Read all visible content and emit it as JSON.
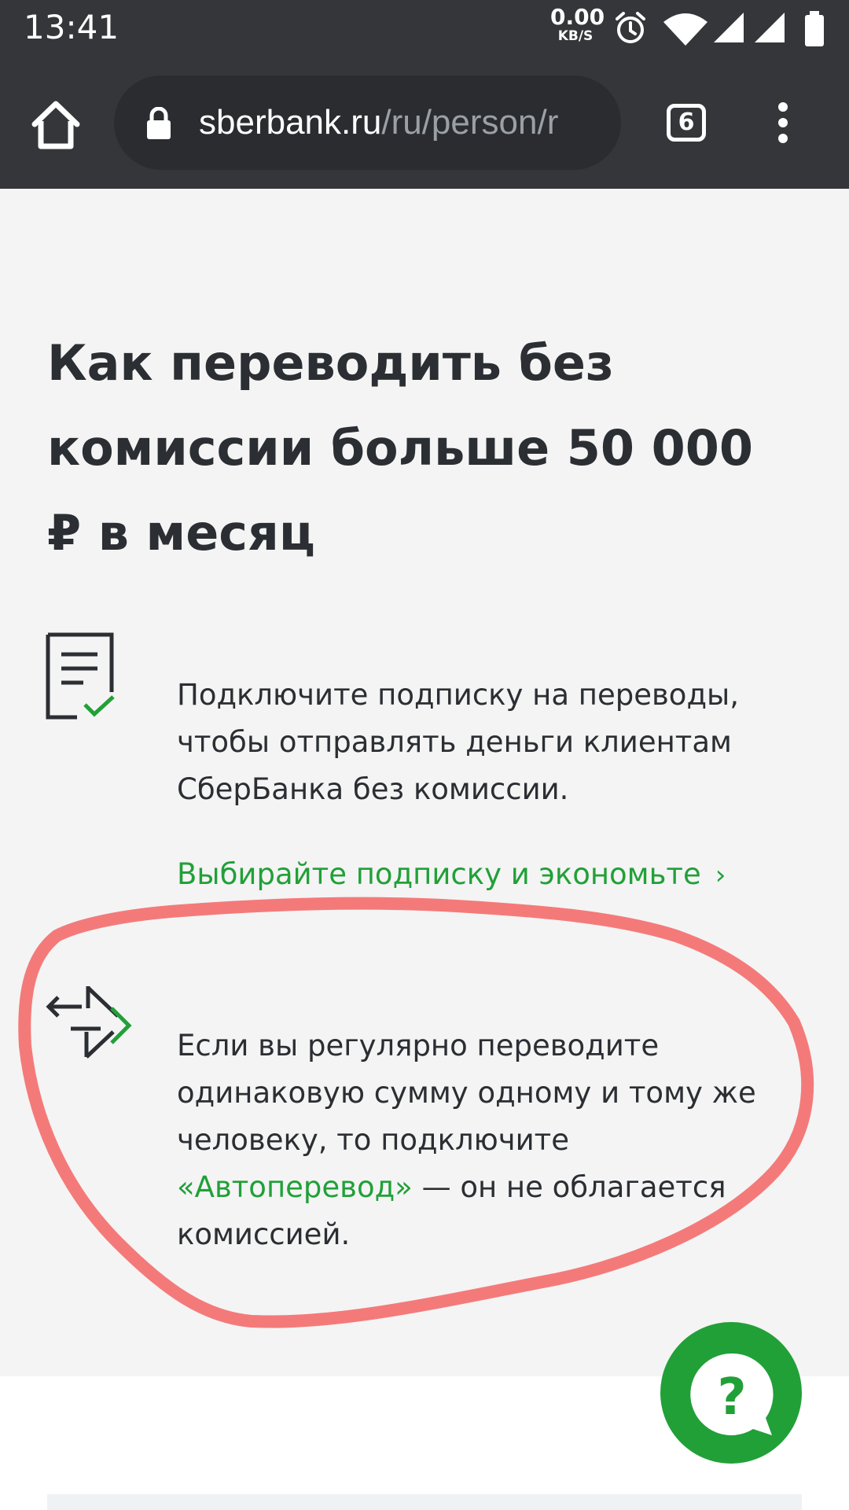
{
  "status_bar": {
    "time": "13:41",
    "net_speed_value": "0.00",
    "net_speed_unit": "KB/S",
    "icons": [
      "alarm-icon",
      "wifi-icon",
      "signal-icon",
      "signal-icon",
      "battery-icon"
    ]
  },
  "browser": {
    "url_host": "sberbank.ru",
    "url_path": "/ru/person/r",
    "tab_count": "6",
    "icons": [
      "home-icon",
      "lock-icon",
      "more-vert-icon"
    ]
  },
  "page": {
    "headline": "Как переводить без комиссии больше 50 000 ₽ в месяц",
    "section1": {
      "icon": "document-check-icon",
      "text": "Подключите подписку на переводы, чтобы отправлять деньги клиентам СберБанка без комиссии.",
      "link_label": "Выбирайте подписку и экономьте",
      "link_chevron": "›"
    },
    "section2": {
      "icon": "transfer-arrows-icon",
      "text_before": "Если вы регулярно переводите одинаковую сумму одному и тому же человеку, то подключите ",
      "link_label": "«Автоперевод»",
      "text_after": " — он не облагается комиссией."
    },
    "help_button": {
      "icon": "help-chat-icon",
      "label": "?"
    }
  },
  "colors": {
    "toolbar": "#35363a",
    "page_background": "#f4f4f4",
    "accent_green": "#21a038",
    "text_dark": "#2b2e32",
    "annotation_red": "#f47a7a"
  }
}
